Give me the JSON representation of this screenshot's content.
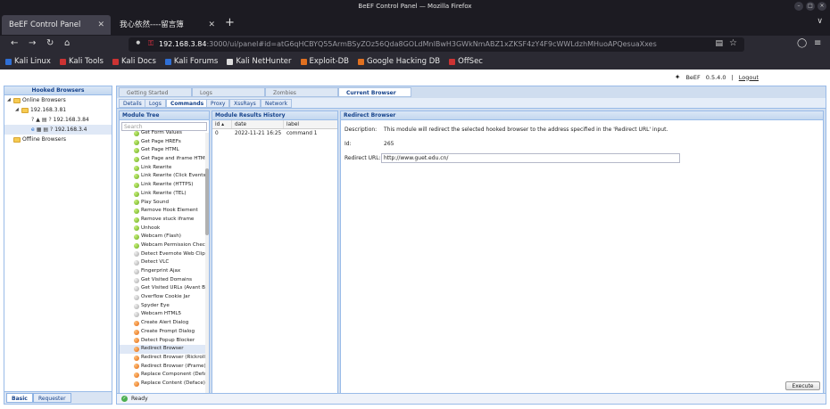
{
  "window": {
    "title": "BeEF Control Panel — Mozilla Firefox"
  },
  "tabs": [
    {
      "label": "BeEF Control Panel",
      "active": true
    },
    {
      "label": "我心依然----留言簿",
      "active": false
    }
  ],
  "address": {
    "host": "192.168.3.84",
    "rest": ":3000/ui/panel#id=atG6qHCBYQ55ArmBSyZOz56Qda8GOLdMnlBwH3GWkNmABZ1xZKSF4zY4F9cWWLdzhMHuoAPQesuaXxes"
  },
  "bookmarks": [
    {
      "label": "Kali Linux",
      "color": "#2f6fd6"
    },
    {
      "label": "Kali Tools",
      "color": "#c33"
    },
    {
      "label": "Kali Docs",
      "color": "#c33"
    },
    {
      "label": "Kali Forums",
      "color": "#2f6fd6"
    },
    {
      "label": "Kali NetHunter",
      "color": "#ddd"
    },
    {
      "label": "Exploit-DB",
      "color": "#e07020"
    },
    {
      "label": "Google Hacking DB",
      "color": "#e07020"
    },
    {
      "label": "OffSec",
      "color": "#c33"
    }
  ],
  "beef": {
    "product": "BeEF",
    "version": "0.5.4.0",
    "separator": "|",
    "logout": "Logout"
  },
  "hooked": {
    "title": "Hooked Browsers",
    "online": "Online Browsers",
    "subnet": "192.168.3.81",
    "browsers": [
      "192.168.3.84",
      "192.168.3.4"
    ],
    "offline": "Offline Browsers",
    "bottom_tabs": [
      "Basic",
      "Requester"
    ]
  },
  "main_tabs": [
    "Getting Started",
    "Logs",
    "Zombies",
    "Current Browser"
  ],
  "sub_tabs": [
    "Details",
    "Logs",
    "Commands",
    "Proxy",
    "XssRays",
    "Network"
  ],
  "module_tree": {
    "title": "Module Tree",
    "search_placeholder": "Search",
    "modules": [
      {
        "label": "Get Form Values",
        "status": "green"
      },
      {
        "label": "Get Page HREFs",
        "status": "green"
      },
      {
        "label": "Get Page HTML",
        "status": "green"
      },
      {
        "label": "Get Page and iframe HTML",
        "status": "green"
      },
      {
        "label": "Link Rewrite",
        "status": "green"
      },
      {
        "label": "Link Rewrite (Click Events)",
        "status": "green"
      },
      {
        "label": "Link Rewrite (HTTPS)",
        "status": "green"
      },
      {
        "label": "Link Rewrite (TEL)",
        "status": "green"
      },
      {
        "label": "Play Sound",
        "status": "green"
      },
      {
        "label": "Remove Hook Element",
        "status": "green"
      },
      {
        "label": "Remove stuck iframe",
        "status": "green"
      },
      {
        "label": "Unhook",
        "status": "green"
      },
      {
        "label": "Webcam (Flash)",
        "status": "green"
      },
      {
        "label": "Webcam Permission Check",
        "status": "green"
      },
      {
        "label": "Detect Evernote Web Clipper",
        "status": "grey"
      },
      {
        "label": "Detect VLC",
        "status": "grey"
      },
      {
        "label": "Fingerprint Ajax",
        "status": "grey"
      },
      {
        "label": "Get Visited Domains",
        "status": "grey"
      },
      {
        "label": "Get Visited URLs (Avant Br",
        "status": "grey"
      },
      {
        "label": "Overflow Cookie Jar",
        "status": "grey"
      },
      {
        "label": "Spyder Eye",
        "status": "grey"
      },
      {
        "label": "Webcam HTML5",
        "status": "grey"
      },
      {
        "label": "Create Alert Dialog",
        "status": "orange"
      },
      {
        "label": "Create Prompt Dialog",
        "status": "orange"
      },
      {
        "label": "Detect Popup Blocker",
        "status": "orange"
      },
      {
        "label": "Redirect Browser",
        "status": "orange",
        "selected": true
      },
      {
        "label": "Redirect Browser (Rickroll)",
        "status": "orange"
      },
      {
        "label": "Redirect Browser (iFrame)",
        "status": "orange"
      },
      {
        "label": "Replace Component (Deface)",
        "status": "orange"
      },
      {
        "label": "Replace Content (Deface)",
        "status": "orange"
      }
    ]
  },
  "results": {
    "title": "Module Results History",
    "headers": [
      "id ▴",
      "date",
      "label"
    ],
    "rows": [
      {
        "id": "0",
        "date": "2022-11-21 16:25",
        "label": "command 1"
      }
    ]
  },
  "redirect": {
    "title": "Redirect Browser",
    "description_label": "Description:",
    "description": "This module will redirect the selected hooked browser to the address specified in the 'Redirect URL' input.",
    "id_label": "Id:",
    "id": "265",
    "url_label": "Redirect URL:",
    "url_value": "http://www.guet.edu.cn/",
    "execute": "Execute"
  },
  "status": {
    "text": "Ready"
  }
}
